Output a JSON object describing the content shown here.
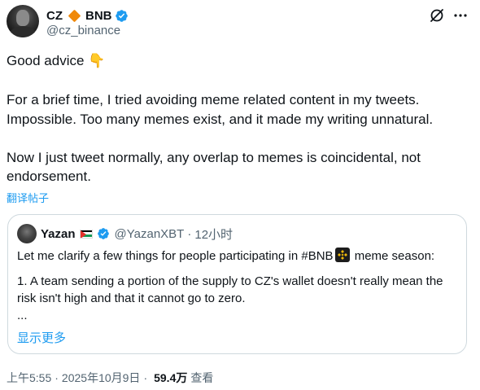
{
  "author": {
    "display_name": "CZ",
    "name_suffix": "BNB",
    "handle": "@cz_binance",
    "verified": true,
    "accent_color": "#f0890a"
  },
  "tweet": {
    "line1": "Good advice ",
    "line1_emoji": "👇",
    "paragraph2": "For a brief time, I tried avoiding meme related content in my tweets. Impossible. Too many memes exist, and it made my writing unnatural.",
    "paragraph3": "Now I just tweet normally, any overlap to memes is coincidental, not endorsement.",
    "translate_label": "翻译帖子"
  },
  "quote": {
    "display_name": "Yazan",
    "handle": "@YazanXBT",
    "separator": "·",
    "time": "12小时",
    "verified": true,
    "line1_before": "Let me clarify a few things for people participating in #BNB",
    "line1_after": " meme season:",
    "point1": "1. A team sending a portion of the supply to CZ's wallet doesn't really mean the risk isn't high and that it cannot go to zero.",
    "ellipsis": "...",
    "show_more": "显示更多"
  },
  "meta": {
    "time": "上午5:55",
    "separator1": "·",
    "date": "2025年10月9日",
    "separator2": "·",
    "views": "59.4万",
    "views_label": "查看"
  },
  "icons": {
    "verified": "verified-badge-icon",
    "grok": "grok-icon",
    "more": "more-dots-icon",
    "bnb": "bnb-logo-icon",
    "flag": "palestine-flag-icon"
  },
  "colors": {
    "link": "#1d9bf0",
    "secondary_text": "#536471",
    "primary_text": "#0f1419",
    "border": "#cfd9de"
  }
}
